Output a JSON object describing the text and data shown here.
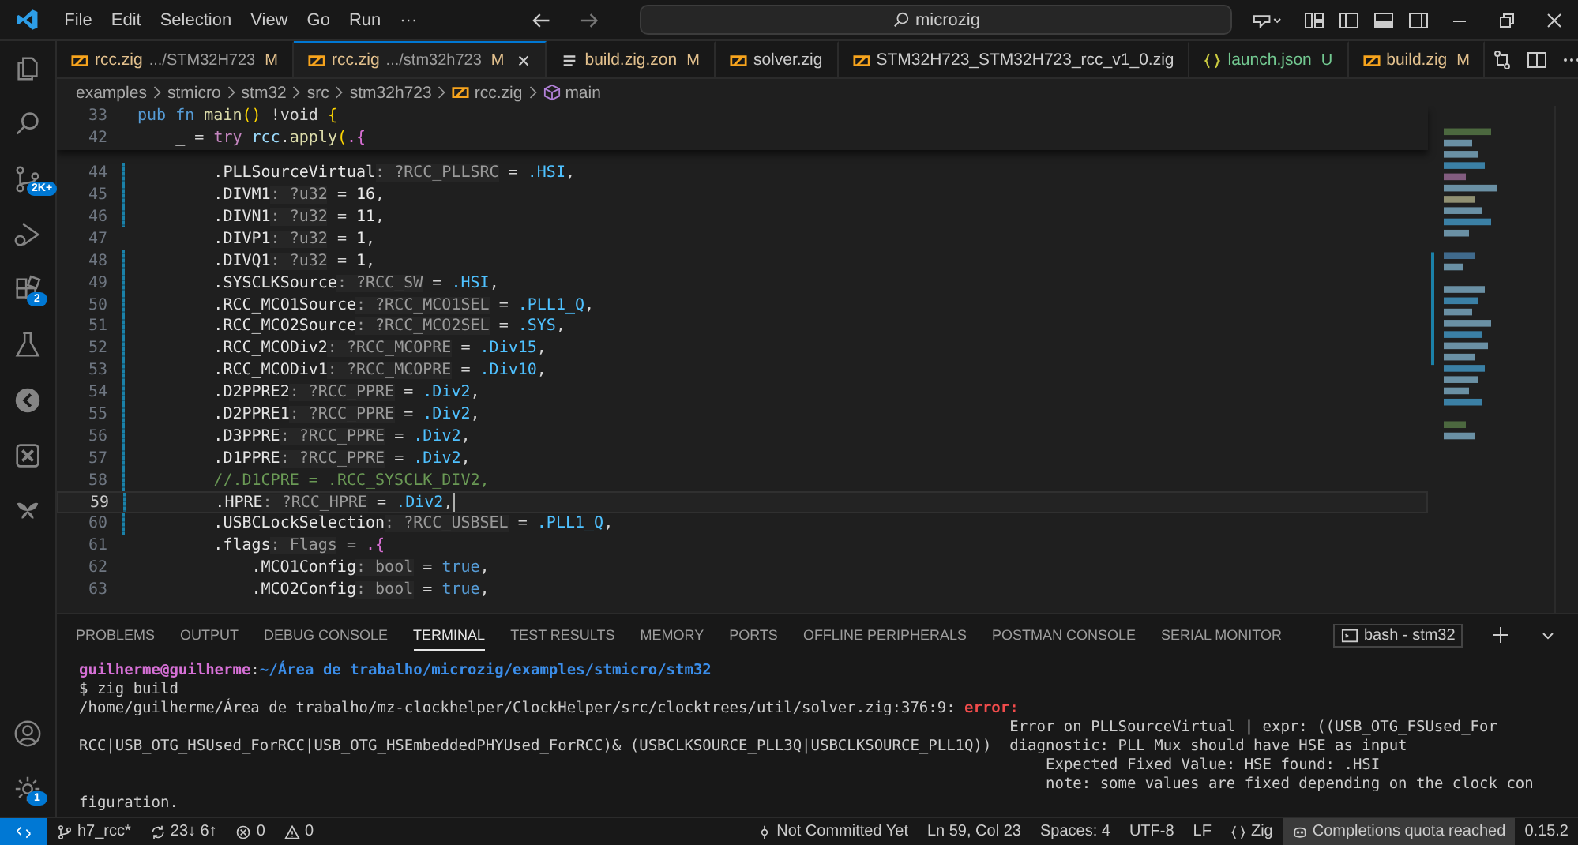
{
  "title_bar": {
    "menu": [
      "File",
      "Edit",
      "Selection",
      "View",
      "Go",
      "Run",
      "···"
    ],
    "search": {
      "value": "microzig"
    }
  },
  "activity_bar": {
    "items": [
      {
        "kind": "files"
      },
      {
        "kind": "search"
      },
      {
        "kind": "source-control",
        "badge": "2K+"
      },
      {
        "kind": "run-debug"
      },
      {
        "kind": "extensions",
        "badge": "2"
      },
      {
        "kind": "flask"
      },
      {
        "kind": "circle-arrow"
      },
      {
        "kind": "x-box"
      },
      {
        "kind": "butterfly"
      }
    ],
    "bottom": [
      {
        "kind": "account"
      },
      {
        "kind": "gear",
        "badge": "1"
      }
    ]
  },
  "tabs": [
    {
      "kind": "zig",
      "label": "rcc.zig",
      "description": ".../STM32H723",
      "badge": "M",
      "modified": true,
      "untracked": false,
      "selected": false
    },
    {
      "kind": "zig",
      "label": "rcc.zig",
      "description": ".../stm32h723",
      "badge": "M",
      "modified": true,
      "untracked": false,
      "selected": true
    },
    {
      "kind": "lines",
      "label": "build.zig.zon",
      "badge": "M",
      "modified": true,
      "untracked": false,
      "selected": false
    },
    {
      "kind": "zig",
      "label": "solver.zig",
      "modified": false,
      "untracked": false,
      "selected": false
    },
    {
      "kind": "zig",
      "label": "STM32H723_STM32H723_rcc_v1_0.zig",
      "modified": false,
      "untracked": false,
      "selected": false
    },
    {
      "kind": "json",
      "label": "launch.json",
      "badge": "U",
      "modified": false,
      "untracked": true,
      "selected": false
    },
    {
      "kind": "zig",
      "label": "build.zig",
      "badge": "M",
      "modified": true,
      "untracked": false,
      "selected": false
    }
  ],
  "breadcrumbs": [
    {
      "label": "examples"
    },
    {
      "label": "stmicro"
    },
    {
      "label": "stm32"
    },
    {
      "label": "src"
    },
    {
      "label": "stm32h723"
    },
    {
      "label": "rcc.zig",
      "kind": "zig"
    },
    {
      "label": "main",
      "kind": "cube"
    }
  ],
  "sticky_lines": [
    {
      "number": "33",
      "tokens": [
        {
          "kind": "keyword",
          "text": "pub fn "
        },
        {
          "kind": "function",
          "text": "main"
        },
        {
          "kind": "bracket",
          "text": "()"
        },
        {
          "kind": "plain",
          "text": " !void "
        },
        {
          "kind": "bracket",
          "text": "{"
        }
      ]
    },
    {
      "number": "42",
      "tokens": [
        {
          "kind": "plain",
          "text": "    _ = "
        },
        {
          "kind": "control",
          "text": "try "
        },
        {
          "kind": "variable",
          "text": "rcc"
        },
        {
          "kind": "plain",
          "text": "."
        },
        {
          "kind": "function",
          "text": "apply"
        },
        {
          "kind": "bracket",
          "text": "("
        },
        {
          "kind": "bracket2",
          "text": ".{"
        }
      ]
    }
  ],
  "code_lines": [
    {
      "number": "44",
      "changed": true,
      "selected": false,
      "tokens": [
        {
          "kind": "field",
          "text": "        .PLLSourceVirtual"
        },
        {
          "kind": "hint",
          "text": ": ?RCC_PLLSRC"
        },
        {
          "kind": "plain",
          "text": " = "
        },
        {
          "kind": "enum",
          "text": ".HSI"
        },
        {
          "kind": "plain",
          "text": ","
        }
      ]
    },
    {
      "number": "45",
      "changed": true,
      "selected": false,
      "tokens": [
        {
          "kind": "field",
          "text": "        .DIVM1"
        },
        {
          "kind": "hint",
          "text": ": ?u32"
        },
        {
          "kind": "plain",
          "text": " = "
        },
        {
          "kind": "number",
          "text": "16"
        },
        {
          "kind": "plain",
          "text": ","
        }
      ]
    },
    {
      "number": "46",
      "changed": true,
      "selected": false,
      "tokens": [
        {
          "kind": "field",
          "text": "        .DIVN1"
        },
        {
          "kind": "hint",
          "text": ": ?u32"
        },
        {
          "kind": "plain",
          "text": " = "
        },
        {
          "kind": "number",
          "text": "11"
        },
        {
          "kind": "plain",
          "text": ","
        }
      ]
    },
    {
      "number": "47",
      "changed": false,
      "selected": false,
      "tokens": [
        {
          "kind": "field",
          "text": "        .DIVP1"
        },
        {
          "kind": "hint",
          "text": ": ?u32"
        },
        {
          "kind": "plain",
          "text": " = "
        },
        {
          "kind": "number",
          "text": "1"
        },
        {
          "kind": "plain",
          "text": ","
        }
      ]
    },
    {
      "number": "48",
      "changed": true,
      "selected": false,
      "tokens": [
        {
          "kind": "field",
          "text": "        .DIVQ1"
        },
        {
          "kind": "hint",
          "text": ": ?u32"
        },
        {
          "kind": "plain",
          "text": " = "
        },
        {
          "kind": "number",
          "text": "1"
        },
        {
          "kind": "plain",
          "text": ","
        }
      ]
    },
    {
      "number": "49",
      "changed": true,
      "selected": false,
      "tokens": [
        {
          "kind": "field",
          "text": "        .SYSCLKSource"
        },
        {
          "kind": "hint",
          "text": ": ?RCC_SW"
        },
        {
          "kind": "plain",
          "text": " = "
        },
        {
          "kind": "enum",
          "text": ".HSI"
        },
        {
          "kind": "plain",
          "text": ","
        }
      ]
    },
    {
      "number": "50",
      "changed": true,
      "selected": false,
      "tokens": [
        {
          "kind": "field",
          "text": "        .RCC_MCO1Source"
        },
        {
          "kind": "hint",
          "text": ": ?RCC_MCO1SEL"
        },
        {
          "kind": "plain",
          "text": " = "
        },
        {
          "kind": "enum",
          "text": ".PLL1_Q"
        },
        {
          "kind": "plain",
          "text": ","
        }
      ]
    },
    {
      "number": "51",
      "changed": true,
      "selected": false,
      "tokens": [
        {
          "kind": "field",
          "text": "        .RCC_MCO2Source"
        },
        {
          "kind": "hint",
          "text": ": ?RCC_MCO2SEL"
        },
        {
          "kind": "plain",
          "text": " = "
        },
        {
          "kind": "enum",
          "text": ".SYS"
        },
        {
          "kind": "plain",
          "text": ","
        }
      ]
    },
    {
      "number": "52",
      "changed": true,
      "selected": false,
      "tokens": [
        {
          "kind": "field",
          "text": "        .RCC_MCODiv2"
        },
        {
          "kind": "hint",
          "text": ": ?RCC_MCOPRE"
        },
        {
          "kind": "plain",
          "text": " = "
        },
        {
          "kind": "enum",
          "text": ".Div15"
        },
        {
          "kind": "plain",
          "text": ","
        }
      ]
    },
    {
      "number": "53",
      "changed": true,
      "selected": false,
      "tokens": [
        {
          "kind": "field",
          "text": "        .RCC_MCODiv1"
        },
        {
          "kind": "hint",
          "text": ": ?RCC_MCOPRE"
        },
        {
          "kind": "plain",
          "text": " = "
        },
        {
          "kind": "enum",
          "text": ".Div10"
        },
        {
          "kind": "plain",
          "text": ","
        }
      ]
    },
    {
      "number": "54",
      "changed": true,
      "selected": false,
      "tokens": [
        {
          "kind": "field",
          "text": "        .D2PPRE2"
        },
        {
          "kind": "hint",
          "text": ": ?RCC_PPRE"
        },
        {
          "kind": "plain",
          "text": " = "
        },
        {
          "kind": "enum",
          "text": ".Div2"
        },
        {
          "kind": "plain",
          "text": ","
        }
      ]
    },
    {
      "number": "55",
      "changed": true,
      "selected": false,
      "tokens": [
        {
          "kind": "field",
          "text": "        .D2PPRE1"
        },
        {
          "kind": "hint",
          "text": ": ?RCC_PPRE"
        },
        {
          "kind": "plain",
          "text": " = "
        },
        {
          "kind": "enum",
          "text": ".Div2"
        },
        {
          "kind": "plain",
          "text": ","
        }
      ]
    },
    {
      "number": "56",
      "changed": true,
      "selected": false,
      "tokens": [
        {
          "kind": "field",
          "text": "        .D3PPRE"
        },
        {
          "kind": "hint",
          "text": ": ?RCC_PPRE"
        },
        {
          "kind": "plain",
          "text": " = "
        },
        {
          "kind": "enum",
          "text": ".Div2"
        },
        {
          "kind": "plain",
          "text": ","
        }
      ]
    },
    {
      "number": "57",
      "changed": true,
      "selected": false,
      "tokens": [
        {
          "kind": "field",
          "text": "        .D1PPRE"
        },
        {
          "kind": "hint",
          "text": ": ?RCC_PPRE"
        },
        {
          "kind": "plain",
          "text": " = "
        },
        {
          "kind": "enum",
          "text": ".Div2"
        },
        {
          "kind": "plain",
          "text": ","
        }
      ]
    },
    {
      "number": "58",
      "changed": true,
      "selected": false,
      "tokens": [
        {
          "kind": "comment",
          "text": "        //.D1CPRE = .RCC_SYSCLK_DIV2,"
        }
      ]
    },
    {
      "number": "59",
      "changed": true,
      "selected": true,
      "tokens": [
        {
          "kind": "field",
          "text": "        .HPRE"
        },
        {
          "kind": "hint",
          "text": ": ?RCC_HPRE"
        },
        {
          "kind": "plain",
          "text": " = "
        },
        {
          "kind": "enum",
          "text": ".Div2"
        },
        {
          "kind": "plain",
          "text": ","
        }
      ]
    },
    {
      "number": "60",
      "changed": true,
      "selected": false,
      "tokens": [
        {
          "kind": "field",
          "text": "        .USBCLockSelection"
        },
        {
          "kind": "hint",
          "text": ": ?RCC_USBSEL"
        },
        {
          "kind": "plain",
          "text": " = "
        },
        {
          "kind": "enum",
          "text": ".PLL1_Q"
        },
        {
          "kind": "plain",
          "text": ","
        }
      ]
    },
    {
      "number": "61",
      "changed": false,
      "selected": false,
      "tokens": [
        {
          "kind": "field",
          "text": "        .flags"
        },
        {
          "kind": "hint",
          "text": ": Flags"
        },
        {
          "kind": "plain",
          "text": " = "
        },
        {
          "kind": "bracket2",
          "text": ".{"
        }
      ]
    },
    {
      "number": "62",
      "changed": false,
      "selected": false,
      "tokens": [
        {
          "kind": "field",
          "text": "            .MCO1Config"
        },
        {
          "kind": "hint",
          "text": ": bool"
        },
        {
          "kind": "plain",
          "text": " = "
        },
        {
          "kind": "keyword",
          "text": "true"
        },
        {
          "kind": "plain",
          "text": ","
        }
      ]
    },
    {
      "number": "63",
      "changed": false,
      "selected": false,
      "tokens": [
        {
          "kind": "field",
          "text": "            .MCO2Config"
        },
        {
          "kind": "hint",
          "text": ": bool"
        },
        {
          "kind": "plain",
          "text": " = "
        },
        {
          "kind": "keyword",
          "text": "true"
        },
        {
          "kind": "plain",
          "text": ","
        }
      ]
    }
  ],
  "panel": {
    "tabs": [
      {
        "label": "PROBLEMS",
        "selected": false
      },
      {
        "label": "OUTPUT",
        "selected": false
      },
      {
        "label": "DEBUG CONSOLE",
        "selected": false
      },
      {
        "label": "TERMINAL",
        "selected": true
      },
      {
        "label": "TEST RESULTS",
        "selected": false
      },
      {
        "label": "MEMORY",
        "selected": false
      },
      {
        "label": "PORTS",
        "selected": false
      },
      {
        "label": "OFFLINE PERIPHERALS",
        "selected": false
      },
      {
        "label": "POSTMAN CONSOLE",
        "selected": false
      },
      {
        "label": "SERIAL MONITOR",
        "selected": false
      }
    ],
    "terminal_name": "bash - stm32",
    "terminal": [
      [
        {
          "kind": "user",
          "text": "guilherme@guilherme"
        },
        {
          "kind": "plain",
          "text": ":"
        },
        {
          "kind": "path",
          "text": "~/Área de trabalho/microzig/examples/stmicro/stm32"
        }
      ],
      [
        {
          "kind": "plain",
          "text": "$ zig build"
        }
      ],
      [
        {
          "kind": "plain",
          "text": "/home/guilherme/Área de trabalho/mz-clockhelper/ClockHelper/src/clocktrees/util/solver.zig:376:9: "
        },
        {
          "kind": "error",
          "text": "error:"
        }
      ],
      [
        {
          "kind": "plain",
          "text": "                                                                                                       Error on PLLSourceVirtual | expr: ((USB_OTG_FSUsed_For"
        }
      ],
      [
        {
          "kind": "plain",
          "text": "RCC|USB_OTG_HSUsed_ForRCC|USB_OTG_HSEmbeddedPHYUsed_ForRCC)& (USBCLKSOURCE_PLL3Q|USBCLKSOURCE_PLL1Q))  diagnostic: PLL Mux should have HSE as input"
        }
      ],
      [
        {
          "kind": "plain",
          "text": "                                                                                                           Expected Fixed Value: HSE found: .HSI"
        }
      ],
      [
        {
          "kind": "plain",
          "text": "                                                                                                           note: some values are fixed depending on the clock con"
        }
      ],
      [
        {
          "kind": "plain",
          "text": "figuration."
        }
      ]
    ]
  },
  "status_bar": {
    "left": [
      {
        "kind": "branch",
        "label": "h7_rcc*"
      },
      {
        "kind": "sync",
        "label": "23↓ 6↑"
      },
      {
        "kind": "error",
        "label": "0"
      },
      {
        "kind": "warning",
        "label": "0"
      }
    ],
    "right": [
      {
        "kind": "commit",
        "label": "Not Committed Yet",
        "highlighted": false
      },
      {
        "kind": "text",
        "label": "Ln 59, Col 23",
        "highlighted": false
      },
      {
        "kind": "text",
        "label": "Spaces: 4",
        "highlighted": false
      },
      {
        "kind": "text",
        "label": "UTF-8",
        "highlighted": false
      },
      {
        "kind": "text",
        "label": "LF",
        "highlighted": false
      },
      {
        "kind": "braces",
        "label": "Zig",
        "highlighted": false
      },
      {
        "kind": "copilot",
        "label": "Completions quota reached",
        "highlighted": true
      },
      {
        "kind": "text",
        "label": "0.15.2",
        "highlighted": false
      }
    ]
  }
}
